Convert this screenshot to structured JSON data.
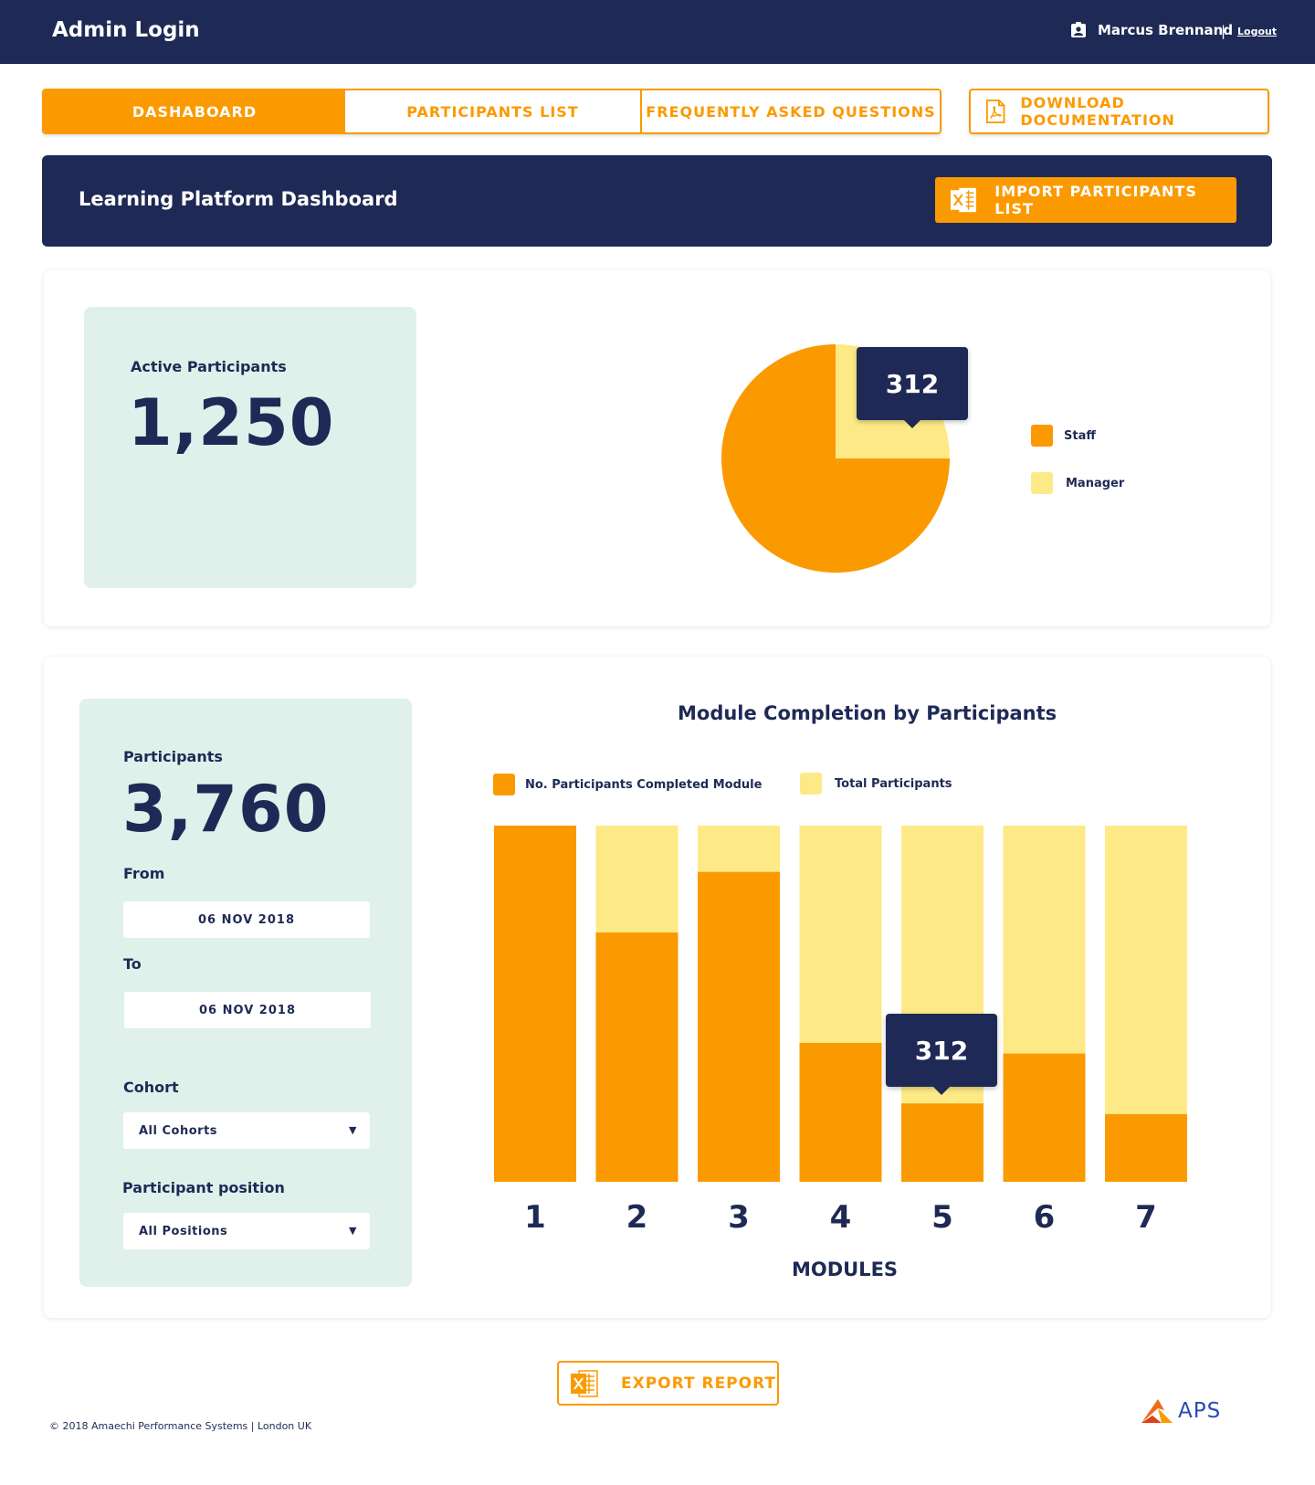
{
  "header": {
    "title": "Admin Login",
    "user_name": "Marcus Brennand",
    "separator": "|",
    "logout_label": "Logout"
  },
  "nav": {
    "tabs": [
      {
        "label": "DASHABOARD",
        "active": true
      },
      {
        "label": "PARTICIPANTS LIST",
        "active": false
      },
      {
        "label": "FREQUENTLY ASKED QUESTIONS",
        "active": false
      }
    ],
    "download_label": "DOWNLOAD DOCUMENTATION"
  },
  "banner": {
    "title": "Learning Platform Dashboard",
    "import_label": "IMPORT PARTICIPANTS LIST"
  },
  "active_participants": {
    "label": "Active Participants",
    "value": "1,250"
  },
  "pie": {
    "tooltip": "312",
    "legend": [
      {
        "label": "Staff",
        "color": "#fb9a00"
      },
      {
        "label": "Manager",
        "color": "#fdea86"
      }
    ]
  },
  "filters": {
    "participants_label": "Participants",
    "participants_value": "3,760",
    "from_label": "From",
    "from_value": "06 NOV 2018",
    "to_label": "To",
    "to_value": "06 NOV 2018",
    "cohort_label": "Cohort",
    "cohort_value": "All Cohorts",
    "position_label": "Participant position",
    "position_value": "All Positions"
  },
  "bar": {
    "title": "Module Completion by Participants",
    "tooltip": "312",
    "xlabel": "MODULES",
    "legend": [
      {
        "label": "No. Participants Completed Module",
        "color": "#fb9a00"
      },
      {
        "label": "Total Participants",
        "color": "#fdea86"
      }
    ]
  },
  "chart_data": [
    {
      "type": "pie",
      "labels": [
        "Staff",
        "Manager"
      ],
      "values": [
        0.75,
        0.25
      ],
      "annotation": "312",
      "colors": [
        "#fb9a00",
        "#fdea86"
      ]
    },
    {
      "type": "bar",
      "title": "Module Completion by Participants",
      "xlabel": "MODULES",
      "categories": [
        "1",
        "2",
        "3",
        "4",
        "5",
        "6",
        "7"
      ],
      "series": [
        {
          "name": "No. Participants Completed Module",
          "values": [
            1.0,
            0.7,
            0.87,
            0.39,
            0.22,
            0.36,
            0.19
          ]
        },
        {
          "name": "Total Participants",
          "values": [
            1,
            1,
            1,
            1,
            1,
            1,
            1
          ]
        }
      ],
      "annotation": "312",
      "colors": [
        "#fb9a00",
        "#fdea86"
      ]
    }
  ],
  "actions": {
    "export_label": "EXPORT REPORT"
  },
  "footer": {
    "copyright": "© 2018 Amaechi Performance Systems | London UK",
    "logo_text": "APS"
  }
}
